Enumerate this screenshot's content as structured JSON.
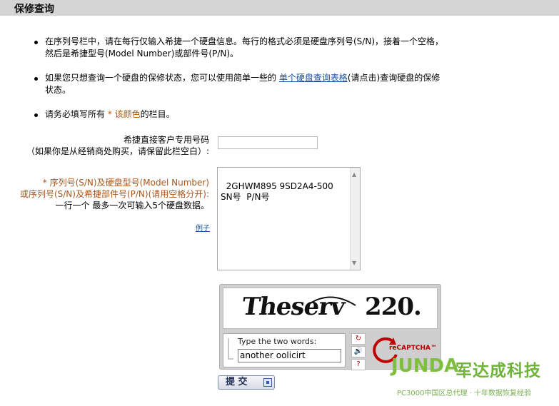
{
  "header": {
    "title": "保修查询"
  },
  "instructions": {
    "item1": "在序列号栏中，请在每行仅输入希捷一个硬盘信息。每行的格式必须是硬盘序列号(S/N)，接着一个空格，然后是希捷型号(Model Number)或部件号(P/N)。",
    "item2_pre": "如果您只想查询一个硬盘的保修状态，您可以使用简单一些的",
    "item2_link": "单个硬盘查询表格",
    "item2_post": "(请点击)查询硬盘的保修状态。",
    "item3_pre": "请务必填写所有",
    "item3_req": "* 该颜色",
    "item3_post": "的栏目。"
  },
  "form": {
    "customer_label_1": "希捷直接客户专用号码",
    "customer_label_2": "（如果你是从经销商处购买，请保留此栏空白）:",
    "serial_label_1": "* 序列号(S/N)及硬盘型号(Model Number)",
    "serial_label_2": "或序列号(S/N)及希捷部件号(P/N)(请用空格分开):",
    "serial_label_3": "一行一个 最多一次可输入5个硬盘数据。",
    "example_link": "例子",
    "serial_value": "2GHWM895 9SD2A4-500\nSN号  P/N号"
  },
  "captcha": {
    "word1": "Theserv",
    "word2": "220.",
    "prompt": "Type the two words:",
    "answer": "another oolicirt",
    "brand": "reCAPTCHA™"
  },
  "submit_label": "提 交",
  "watermark": {
    "logo": "JUNDA",
    "name": "军达成科技",
    "tagline": "PC3000中国区总代理 · 十年数据恢复经验"
  },
  "colors": {
    "required": "#a9541a",
    "link": "#1a4f9c",
    "header_bg": "#d5d5d5"
  }
}
